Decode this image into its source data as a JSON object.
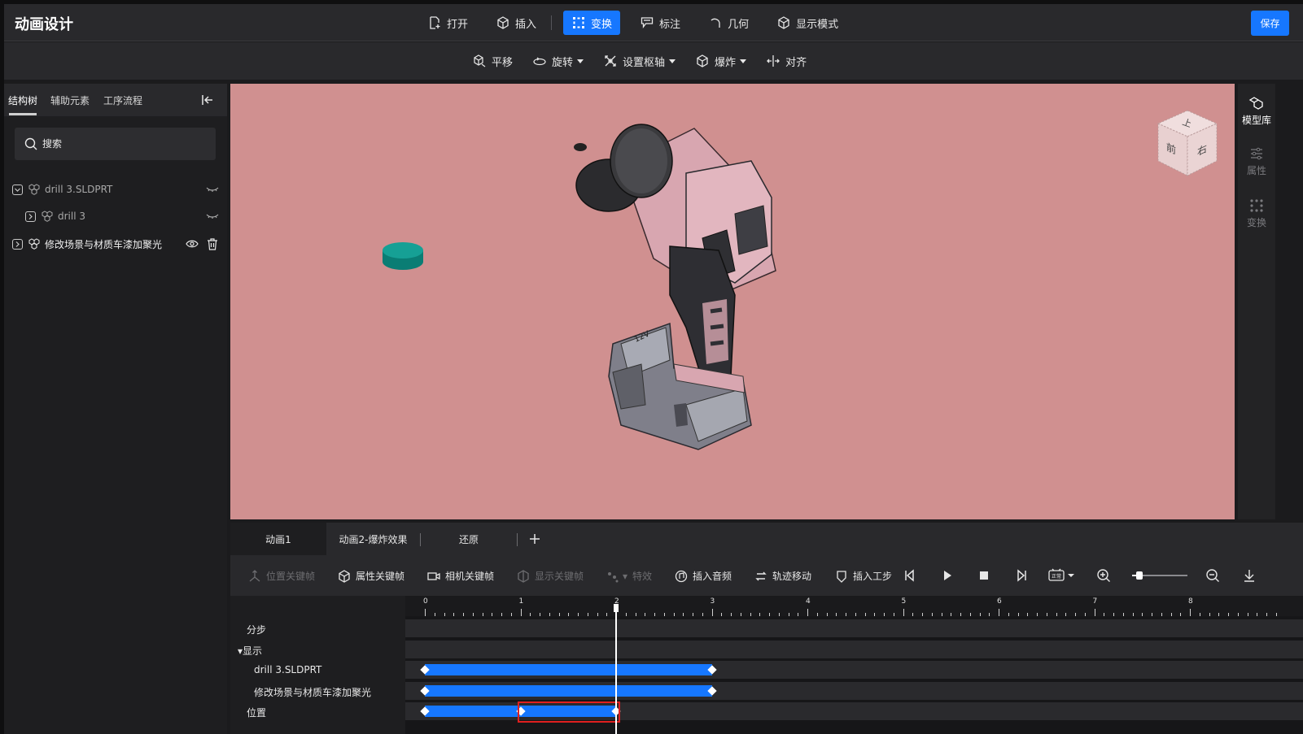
{
  "app": {
    "title": "动画设计",
    "save_label": "保存"
  },
  "menu": [
    {
      "label": "打开",
      "icon": "file-open-icon",
      "active": false
    },
    {
      "label": "插入",
      "icon": "cube-icon",
      "active": false
    },
    {
      "label": "变换",
      "icon": "transform-icon",
      "active": true
    },
    {
      "label": "标注",
      "icon": "annotation-icon",
      "active": false
    },
    {
      "label": "几何",
      "icon": "geometry-icon",
      "active": false
    },
    {
      "label": "显示模式",
      "icon": "display-mode-icon",
      "active": false
    }
  ],
  "submenu": [
    {
      "label": "平移",
      "icon": "translate-icon",
      "dropdown": false
    },
    {
      "label": "旋转",
      "icon": "rotate-icon",
      "dropdown": true
    },
    {
      "label": "设置枢轴",
      "icon": "pivot-icon",
      "dropdown": true
    },
    {
      "label": "爆炸",
      "icon": "explode-icon",
      "dropdown": true
    },
    {
      "label": "对齐",
      "icon": "align-icon",
      "dropdown": false
    }
  ],
  "left_panel": {
    "tabs": [
      "结构树",
      "辅助元素",
      "工序流程"
    ],
    "active_tab": "结构树",
    "search_placeholder": "搜索",
    "tree": [
      {
        "label": "drill 3.SLDPRT",
        "expanded": true,
        "visible": false
      },
      {
        "label": "drill 3",
        "expanded": false,
        "visible": false
      },
      {
        "label": "修改场景与材质车漆加聚光",
        "expanded": false,
        "visible": true
      }
    ]
  },
  "viewport": {
    "background": "#d09090",
    "view_cube": {
      "top": "上",
      "front": "前",
      "right": "右"
    },
    "model_label": "12V"
  },
  "right_panel": [
    {
      "label": "模型库",
      "icon": "model-library-icon",
      "enabled": true
    },
    {
      "label": "属性",
      "icon": "properties-icon",
      "enabled": false
    },
    {
      "label": "变换",
      "icon": "transform-dots-icon",
      "enabled": false
    }
  ],
  "animation_tabs": [
    {
      "label": "动画1",
      "active": true
    },
    {
      "label": "动画2-爆炸效果",
      "active": false
    },
    {
      "label": "还原",
      "active": false
    }
  ],
  "timeline_toolbar": [
    {
      "label": "位置关键帧",
      "icon": "position-keyframe-icon",
      "enabled": false
    },
    {
      "label": "属性关键帧",
      "icon": "property-keyframe-icon",
      "enabled": true
    },
    {
      "label": "相机关键帧",
      "icon": "camera-keyframe-icon",
      "enabled": true
    },
    {
      "label": "显示关键帧",
      "icon": "display-keyframe-icon",
      "enabled": false
    },
    {
      "label": "特效",
      "icon": "effects-icon",
      "enabled": false
    },
    {
      "label": "插入音频",
      "icon": "audio-icon",
      "enabled": true
    },
    {
      "label": "轨迹移动",
      "icon": "trajectory-icon",
      "enabled": true
    },
    {
      "label": "插入工步",
      "icon": "step-icon",
      "enabled": true
    }
  ],
  "playback": {
    "speed_label": "正常",
    "zoom_level": 0.12
  },
  "timeline": {
    "ruler_labels": [
      "0",
      "1",
      "2",
      "3",
      "4",
      "5",
      "6",
      "7",
      "8"
    ],
    "playhead_time": 2,
    "tracks": [
      {
        "label": "分步",
        "indent": 0,
        "bars": []
      },
      {
        "label": "显示",
        "indent": 0,
        "group": true,
        "bars": []
      },
      {
        "label": "drill 3.SLDPRT",
        "indent": 1,
        "bars": [
          {
            "start": 0,
            "end": 3
          }
        ],
        "keyframes": [
          0,
          3
        ]
      },
      {
        "label": "修改场景与材质车漆加聚光",
        "indent": 1,
        "bars": [
          {
            "start": 0,
            "end": 3
          }
        ],
        "keyframes": [
          0,
          3
        ]
      },
      {
        "label": "位置",
        "indent": 0,
        "bars": [
          {
            "start": 0,
            "end": 2
          }
        ],
        "keyframes": [
          0,
          1,
          2
        ],
        "selected_segment": {
          "start": 1,
          "end": 2
        }
      }
    ]
  }
}
